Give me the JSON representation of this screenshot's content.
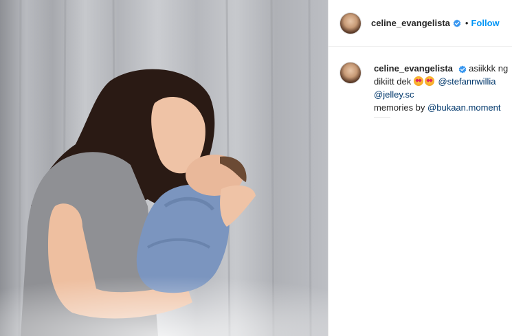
{
  "post": {
    "image_alt": "Woman holding a newborn baby wrapped in a blue blanket"
  },
  "header": {
    "username": "celine_evangelista",
    "separator": "•",
    "follow_label": "Follow"
  },
  "caption": {
    "username": "celine_evangelista",
    "line1_text": "asiikkk ng",
    "line2_text": "dikiitt dek",
    "line2_mention": "@stefannwillia",
    "line3_mention": "@jelley.sc",
    "line4_text": "memories by",
    "line4_mention": "@bukaan.moment"
  },
  "colors": {
    "accent": "#0095f6",
    "mention": "#00376b",
    "text": "#262626"
  },
  "icons": {
    "verified": "verified-badge-icon",
    "emoji": "heart-eyes-emoji-icon"
  }
}
